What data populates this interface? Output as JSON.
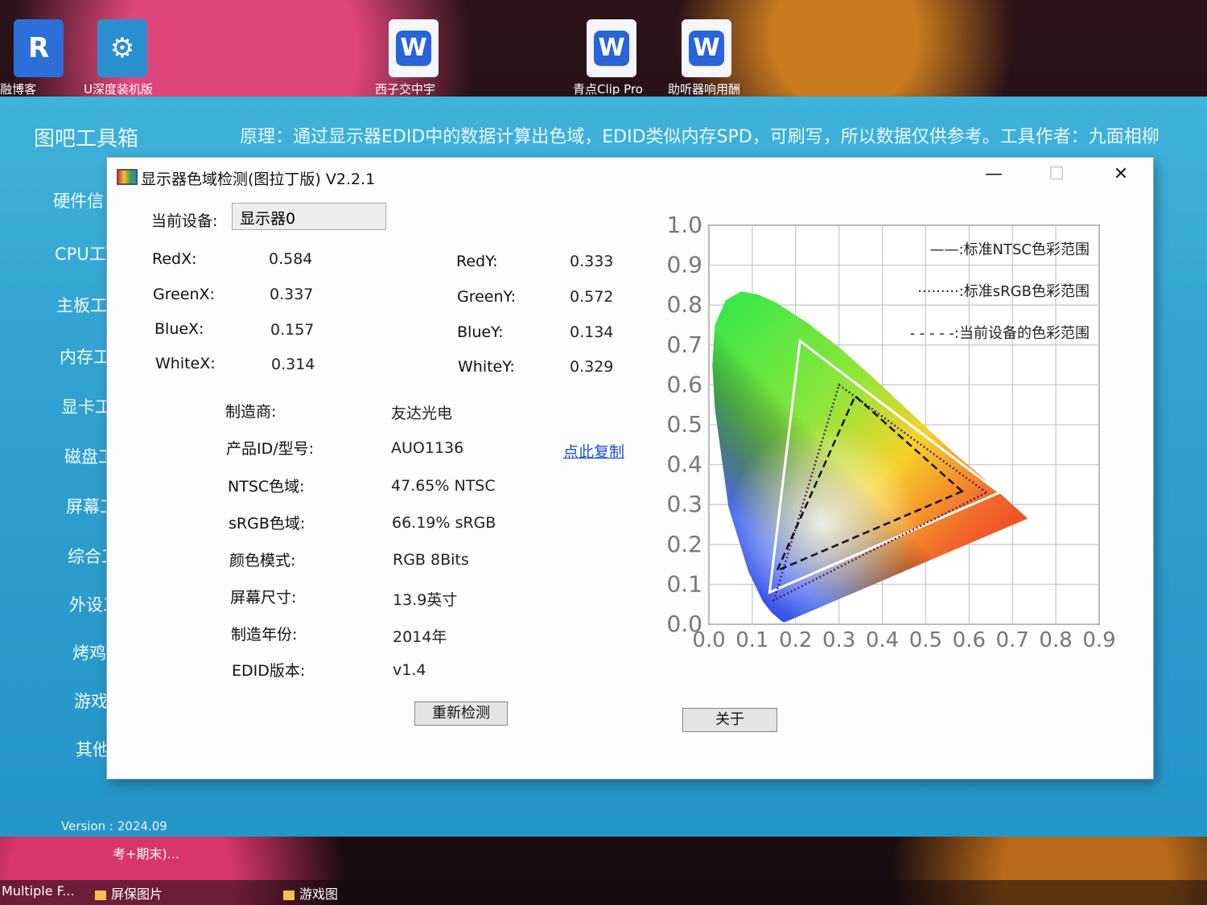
{
  "desktop": {
    "icons": [
      {
        "label": "融博客",
        "kind": "app"
      },
      {
        "label": "U深度装机版",
        "kind": "usb"
      },
      {
        "label": "西子交中宇",
        "kind": "word"
      },
      {
        "label": "青点Clip Pro",
        "kind": "word"
      },
      {
        "label": "助听器响用酬",
        "kind": "word"
      }
    ]
  },
  "host": {
    "title": "图吧工具箱",
    "note": "原理：通过显示器EDID中的数据计算出色域，EDID类似内存SPD，可刷写，所以数据仅供参考。工具作者：九面相柳",
    "sidebar": [
      "硬件信",
      "CPU工",
      "主板工",
      "内存工",
      "显卡工",
      "磁盘工",
      "屏幕工",
      "综合工",
      "外设工",
      "烤鸡工",
      "游戏工",
      "其他工"
    ],
    "version": "Version : 2024.09",
    "footer_text": "考+期末)..."
  },
  "taskbar": {
    "items": [
      "Multiple F...",
      "屏保图片",
      "游戏图"
    ]
  },
  "dialog": {
    "title": "显示器色域检测(图拉丁版) V2.2.1",
    "controls": {
      "minimize": "—",
      "maximize": "☐",
      "close": "✕"
    },
    "device_label": "当前设备:",
    "device_value": "显示器0",
    "coords": {
      "red_x_label": "RedX:",
      "red_x": "0.584",
      "red_y_label": "RedY:",
      "red_y": "0.333",
      "green_x_label": "GreenX:",
      "green_x": "0.337",
      "green_y_label": "GreenY:",
      "green_y": "0.572",
      "blue_x_label": "BlueX:",
      "blue_x": "0.157",
      "blue_y_label": "BlueY:",
      "blue_y": "0.134",
      "white_x_label": "WhiteX:",
      "white_x": "0.314",
      "white_y_label": "WhiteY:",
      "white_y": "0.329"
    },
    "info": [
      {
        "label": "制造商:",
        "value": "友达光电"
      },
      {
        "label": "产品ID/型号:",
        "value": "AUO1136"
      },
      {
        "label": "NTSC色域:",
        "value": "47.65% NTSC"
      },
      {
        "label": "sRGB色域:",
        "value": "66.19% sRGB"
      },
      {
        "label": "颜色模式:",
        "value": "RGB 8Bits"
      },
      {
        "label": "屏幕尺寸:",
        "value": "13.9英寸"
      },
      {
        "label": "制造年份:",
        "value": "2014年"
      },
      {
        "label": "EDID版本:",
        "value": "v1.4"
      }
    ],
    "copy_link": "点此复制",
    "redetect_button": "重新检测",
    "about_button": "关于"
  },
  "chart_data": {
    "type": "scatter",
    "title": "",
    "xlabel": "",
    "ylabel": "",
    "x_ticks": [
      "0.0",
      "0.1",
      "0.2",
      "0.3",
      "0.4",
      "0.5",
      "0.6",
      "0.7",
      "0.8",
      "0.9"
    ],
    "y_ticks": [
      "0.0",
      "0.1",
      "0.2",
      "0.3",
      "0.4",
      "0.5",
      "0.6",
      "0.7",
      "0.8",
      "0.9",
      "1.0"
    ],
    "xlim": [
      0,
      0.9
    ],
    "ylim": [
      0,
      1.0
    ],
    "grid": true,
    "legend_position": "top-right",
    "series": [
      {
        "name": "标准NTSC色彩范围",
        "style": "solid",
        "color": "#ffffff",
        "points": [
          [
            0.67,
            0.33
          ],
          [
            0.21,
            0.71
          ],
          [
            0.14,
            0.08
          ]
        ]
      },
      {
        "name": "标准sRGB色彩范围",
        "style": "dotted",
        "color": "#5a1a6a",
        "points": [
          [
            0.64,
            0.33
          ],
          [
            0.3,
            0.6
          ],
          [
            0.15,
            0.06
          ]
        ]
      },
      {
        "name": "当前设备的色彩范围",
        "style": "dashed",
        "color": "#111111",
        "points": [
          [
            0.584,
            0.333
          ],
          [
            0.337,
            0.572
          ],
          [
            0.157,
            0.134
          ]
        ]
      }
    ],
    "legend_entries": [
      "——:标准NTSC色彩范围",
      "·········:标准sRGB色彩范围",
      "- - - - -:当前设备的色彩范围"
    ]
  }
}
